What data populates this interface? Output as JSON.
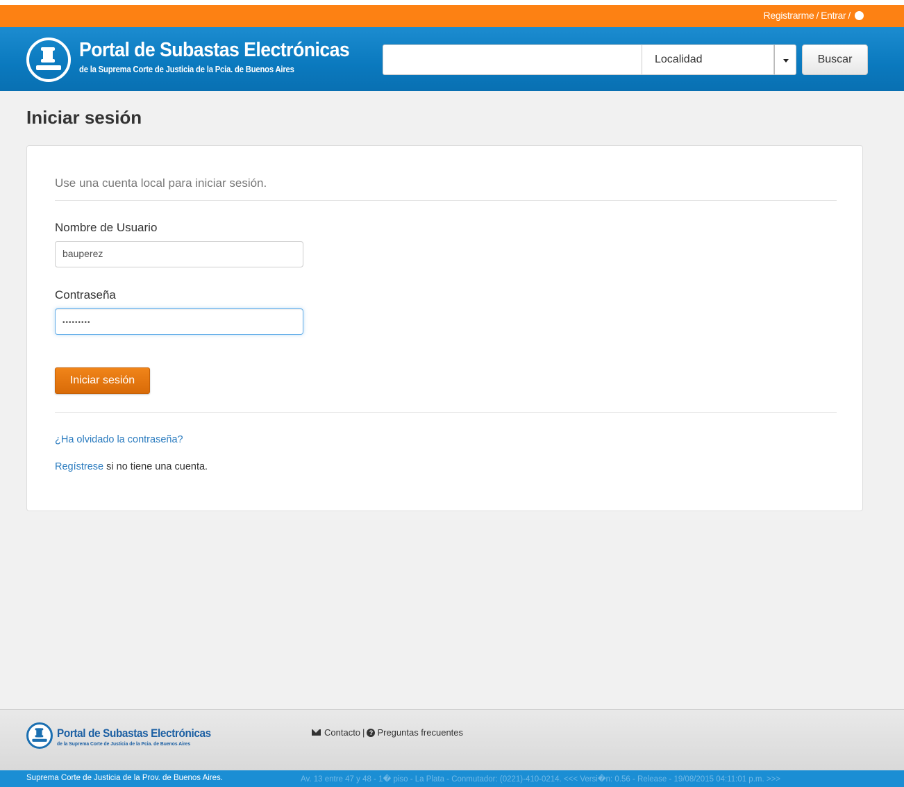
{
  "topbar": {
    "register_label": "Registrarme",
    "separator": "/",
    "login_label": "Entrar",
    "help_icon": "question-circle-icon"
  },
  "header": {
    "logo_title": "Portal de Subastas Electrónicas",
    "logo_subtitle": "de la Suprema Corte de Justicia de la Pcia. de Buenos Aires",
    "search_value": "",
    "locality_selected": "Localidad",
    "search_button": "Buscar"
  },
  "page": {
    "title": "Iniciar sesión"
  },
  "login_form": {
    "lead": "Use una cuenta local para iniciar sesión.",
    "username_label": "Nombre de Usuario",
    "username_value": "bauperez",
    "password_label": "Contraseña",
    "password_mask": "•••••••••",
    "submit_label": "Iniciar sesión",
    "forgot_link": "¿Ha olvidado la contraseña?",
    "register_link": "Regístrese",
    "register_suffix": " si no tiene una cuenta."
  },
  "footer": {
    "logo_title": "Portal de Subastas Electrónicas",
    "logo_subtitle": "de la Suprema Corte de Justicia de la Pcia. de Buenos Aires",
    "contact_label": "Contacto",
    "divider": "|",
    "faq_label": "Preguntas frecuentes",
    "org_name": "Suprema Corte de Justicia de la Prov. de Buenos Aires.",
    "address_info": "Av. 13 entre 47 y 48 - 1� piso - La Plata - Conmutador: (0221)-410-0214. <<< Versi�n: 0.56 - Release - 19/08/2015 04:11:01 p.m. >>>"
  },
  "colors": {
    "top_orange": "#fd8113",
    "header_blue": "#0a79be",
    "button_orange": "#e07310",
    "link_blue": "#2a7bbf",
    "bottom_bar_blue": "#1b8ed4"
  }
}
